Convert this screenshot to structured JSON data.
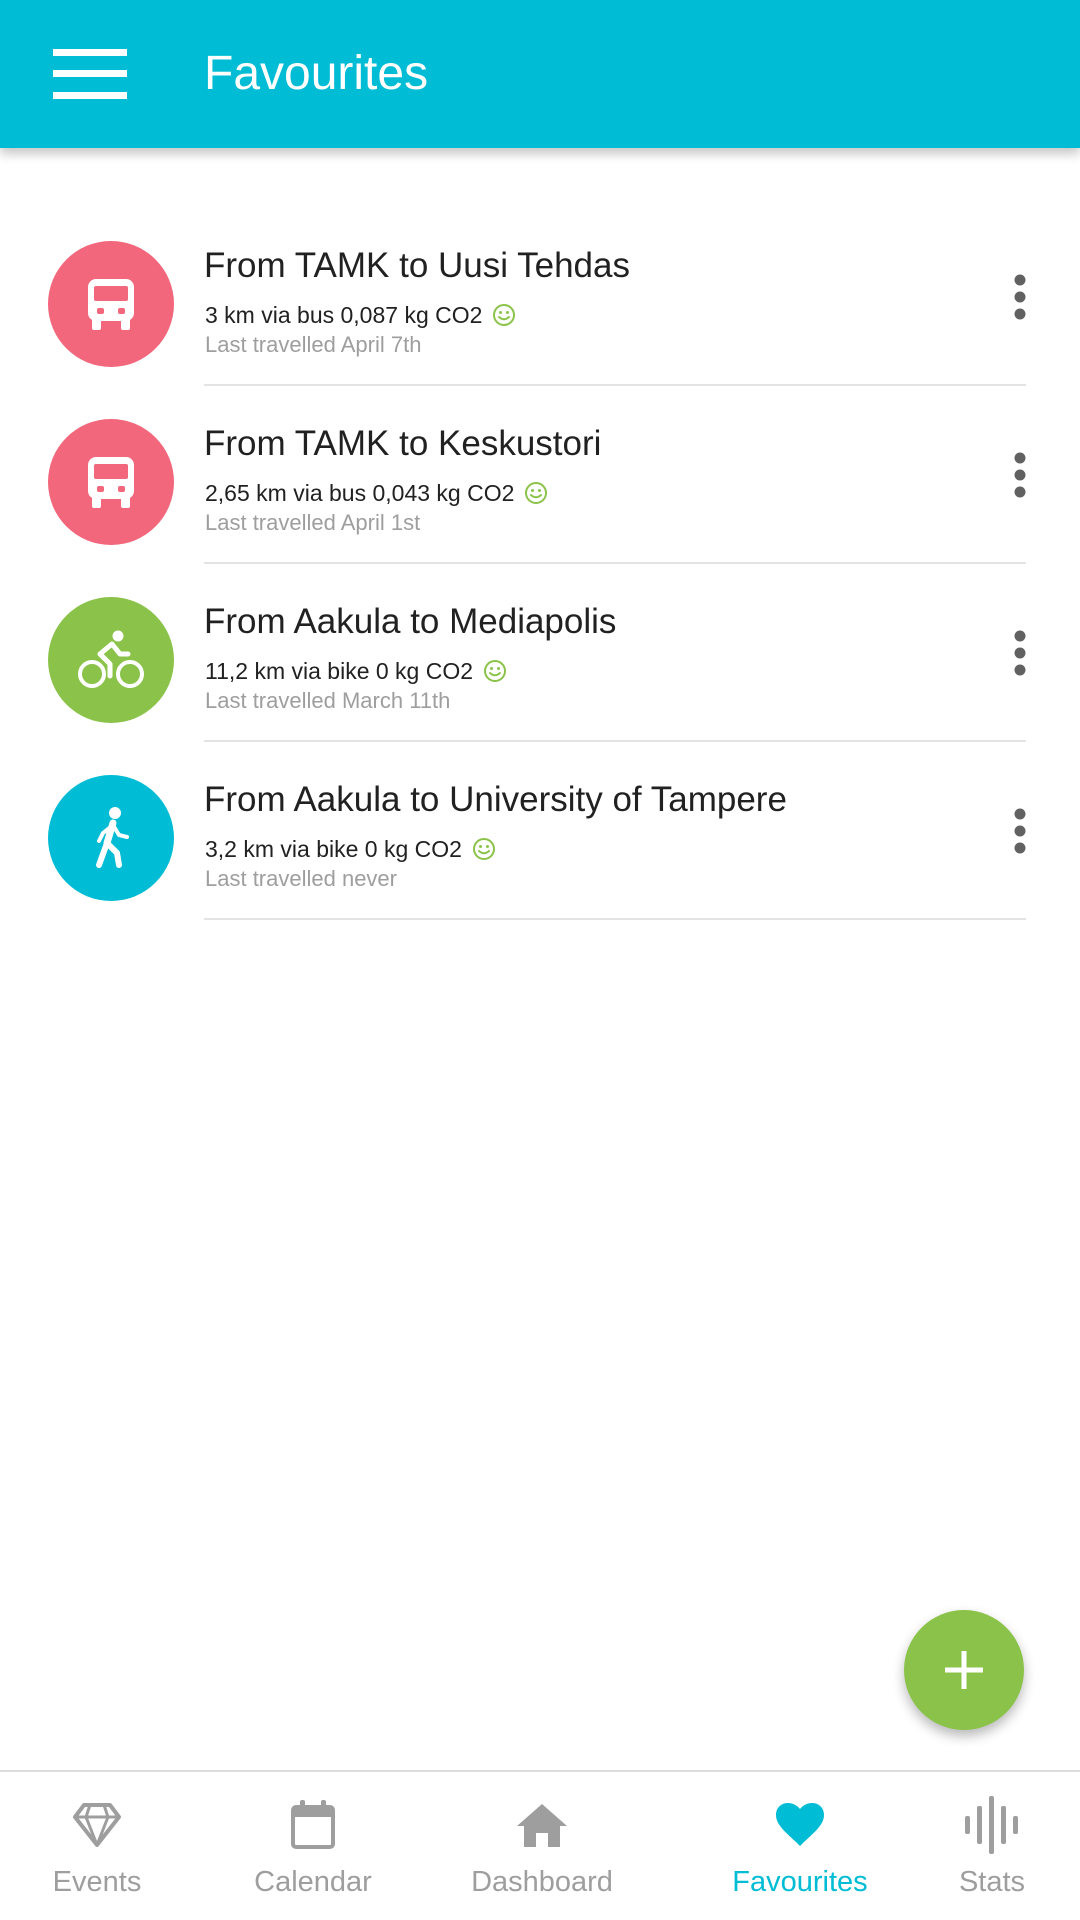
{
  "app_bar": {
    "title": "Favourites",
    "menu_icon": "hamburger-menu-icon",
    "color": "#00BCD4"
  },
  "favourites": [
    {
      "title": "From TAMK to Uusi Tehdas",
      "details": "3 km via bus 0,087 kg CO2",
      "last_travelled": "Last travelled April 7th",
      "mode": "bus",
      "icon": "bus-icon",
      "avatar_color": "#F2677B"
    },
    {
      "title": "From TAMK to Keskustori",
      "details": "2,65 km via bus 0,043 kg CO2",
      "last_travelled": "Last travelled April 1st",
      "mode": "bus",
      "icon": "bus-icon",
      "avatar_color": "#F2677B"
    },
    {
      "title": "From Aakula to Mediapolis",
      "details": "11,2 km via bike 0 kg CO2",
      "last_travelled": "Last travelled March 11th",
      "mode": "bike",
      "icon": "bicycle-icon",
      "avatar_color": "#8BC34A"
    },
    {
      "title": "From Aakula to University of Tampere",
      "details": "3,2 km via bike 0 kg CO2",
      "last_travelled": "Last travelled never",
      "mode": "walk",
      "icon": "walking-icon",
      "avatar_color": "#00BCD4"
    }
  ],
  "fab": {
    "icon": "plus-icon",
    "color": "#8BC34A"
  },
  "bottom_nav": {
    "active": "Favourites",
    "items": [
      {
        "label": "Events",
        "icon": "diamond-icon"
      },
      {
        "label": "Calendar",
        "icon": "calendar-icon"
      },
      {
        "label": "Dashboard",
        "icon": "home-icon"
      },
      {
        "label": "Favourites",
        "icon": "heart-icon"
      },
      {
        "label": "Stats",
        "icon": "stats-bars-icon"
      }
    ]
  },
  "colors": {
    "accent": "#00BCD4",
    "eco_green": "#8BC34A",
    "bus_pink": "#F2677B",
    "inactive_gray": "#9e9e9e"
  }
}
